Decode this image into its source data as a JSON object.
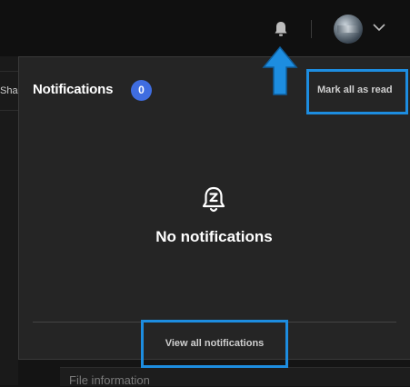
{
  "topbar": {
    "bell_icon": "bell-icon",
    "avatar": "user-avatar",
    "menu_icon": "chevron-down-icon"
  },
  "background": {
    "tab_label": "Sha",
    "card_label": "File information"
  },
  "notifications": {
    "title": "Notifications",
    "count": "0",
    "mark_all_label": "Mark all as read",
    "empty_icon": "bell-snooze-icon",
    "empty_text": "No notifications",
    "view_all_label": "View all notifications"
  },
  "annotations": {
    "highlight_color": "#1d8de0",
    "arrow_icon": "arrow-up-icon"
  },
  "colors": {
    "badge": "#3f6de0",
    "popup_bg": "#252525",
    "topbar_bg": "#101010"
  }
}
